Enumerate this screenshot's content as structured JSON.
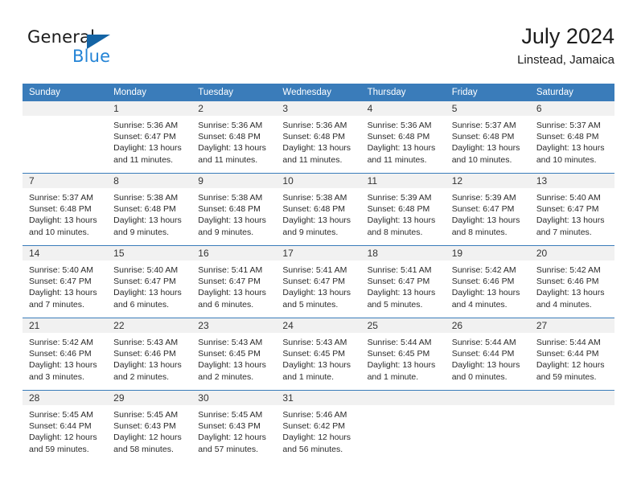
{
  "brand": {
    "word_one": "General",
    "word_two": "Blue",
    "accent_color": "#2484d6",
    "triangle_color": "#1464a5",
    "triangle_icon": "triangle-icon"
  },
  "header": {
    "title": "July 2024",
    "subtitle": "Linstead, Jamaica"
  },
  "theme": {
    "header_blue": "#3a7cba",
    "date_band_gray": "#f1f1f1",
    "text_color": "#2a2a2a"
  },
  "calendar": {
    "day_names": [
      "Sunday",
      "Monday",
      "Tuesday",
      "Wednesday",
      "Thursday",
      "Friday",
      "Saturday"
    ],
    "weeks": [
      [
        {
          "day": "",
          "lines": []
        },
        {
          "day": "1",
          "lines": [
            "Sunrise: 5:36 AM",
            "Sunset: 6:47 PM",
            "Daylight: 13 hours",
            "and 11 minutes."
          ]
        },
        {
          "day": "2",
          "lines": [
            "Sunrise: 5:36 AM",
            "Sunset: 6:48 PM",
            "Daylight: 13 hours",
            "and 11 minutes."
          ]
        },
        {
          "day": "3",
          "lines": [
            "Sunrise: 5:36 AM",
            "Sunset: 6:48 PM",
            "Daylight: 13 hours",
            "and 11 minutes."
          ]
        },
        {
          "day": "4",
          "lines": [
            "Sunrise: 5:36 AM",
            "Sunset: 6:48 PM",
            "Daylight: 13 hours",
            "and 11 minutes."
          ]
        },
        {
          "day": "5",
          "lines": [
            "Sunrise: 5:37 AM",
            "Sunset: 6:48 PM",
            "Daylight: 13 hours",
            "and 10 minutes."
          ]
        },
        {
          "day": "6",
          "lines": [
            "Sunrise: 5:37 AM",
            "Sunset: 6:48 PM",
            "Daylight: 13 hours",
            "and 10 minutes."
          ]
        }
      ],
      [
        {
          "day": "7",
          "lines": [
            "Sunrise: 5:37 AM",
            "Sunset: 6:48 PM",
            "Daylight: 13 hours",
            "and 10 minutes."
          ]
        },
        {
          "day": "8",
          "lines": [
            "Sunrise: 5:38 AM",
            "Sunset: 6:48 PM",
            "Daylight: 13 hours",
            "and 9 minutes."
          ]
        },
        {
          "day": "9",
          "lines": [
            "Sunrise: 5:38 AM",
            "Sunset: 6:48 PM",
            "Daylight: 13 hours",
            "and 9 minutes."
          ]
        },
        {
          "day": "10",
          "lines": [
            "Sunrise: 5:38 AM",
            "Sunset: 6:48 PM",
            "Daylight: 13 hours",
            "and 9 minutes."
          ]
        },
        {
          "day": "11",
          "lines": [
            "Sunrise: 5:39 AM",
            "Sunset: 6:48 PM",
            "Daylight: 13 hours",
            "and 8 minutes."
          ]
        },
        {
          "day": "12",
          "lines": [
            "Sunrise: 5:39 AM",
            "Sunset: 6:47 PM",
            "Daylight: 13 hours",
            "and 8 minutes."
          ]
        },
        {
          "day": "13",
          "lines": [
            "Sunrise: 5:40 AM",
            "Sunset: 6:47 PM",
            "Daylight: 13 hours",
            "and 7 minutes."
          ]
        }
      ],
      [
        {
          "day": "14",
          "lines": [
            "Sunrise: 5:40 AM",
            "Sunset: 6:47 PM",
            "Daylight: 13 hours",
            "and 7 minutes."
          ]
        },
        {
          "day": "15",
          "lines": [
            "Sunrise: 5:40 AM",
            "Sunset: 6:47 PM",
            "Daylight: 13 hours",
            "and 6 minutes."
          ]
        },
        {
          "day": "16",
          "lines": [
            "Sunrise: 5:41 AM",
            "Sunset: 6:47 PM",
            "Daylight: 13 hours",
            "and 6 minutes."
          ]
        },
        {
          "day": "17",
          "lines": [
            "Sunrise: 5:41 AM",
            "Sunset: 6:47 PM",
            "Daylight: 13 hours",
            "and 5 minutes."
          ]
        },
        {
          "day": "18",
          "lines": [
            "Sunrise: 5:41 AM",
            "Sunset: 6:47 PM",
            "Daylight: 13 hours",
            "and 5 minutes."
          ]
        },
        {
          "day": "19",
          "lines": [
            "Sunrise: 5:42 AM",
            "Sunset: 6:46 PM",
            "Daylight: 13 hours",
            "and 4 minutes."
          ]
        },
        {
          "day": "20",
          "lines": [
            "Sunrise: 5:42 AM",
            "Sunset: 6:46 PM",
            "Daylight: 13 hours",
            "and 4 minutes."
          ]
        }
      ],
      [
        {
          "day": "21",
          "lines": [
            "Sunrise: 5:42 AM",
            "Sunset: 6:46 PM",
            "Daylight: 13 hours",
            "and 3 minutes."
          ]
        },
        {
          "day": "22",
          "lines": [
            "Sunrise: 5:43 AM",
            "Sunset: 6:46 PM",
            "Daylight: 13 hours",
            "and 2 minutes."
          ]
        },
        {
          "day": "23",
          "lines": [
            "Sunrise: 5:43 AM",
            "Sunset: 6:45 PM",
            "Daylight: 13 hours",
            "and 2 minutes."
          ]
        },
        {
          "day": "24",
          "lines": [
            "Sunrise: 5:43 AM",
            "Sunset: 6:45 PM",
            "Daylight: 13 hours",
            "and 1 minute."
          ]
        },
        {
          "day": "25",
          "lines": [
            "Sunrise: 5:44 AM",
            "Sunset: 6:45 PM",
            "Daylight: 13 hours",
            "and 1 minute."
          ]
        },
        {
          "day": "26",
          "lines": [
            "Sunrise: 5:44 AM",
            "Sunset: 6:44 PM",
            "Daylight: 13 hours",
            "and 0 minutes."
          ]
        },
        {
          "day": "27",
          "lines": [
            "Sunrise: 5:44 AM",
            "Sunset: 6:44 PM",
            "Daylight: 12 hours",
            "and 59 minutes."
          ]
        }
      ],
      [
        {
          "day": "28",
          "lines": [
            "Sunrise: 5:45 AM",
            "Sunset: 6:44 PM",
            "Daylight: 12 hours",
            "and 59 minutes."
          ]
        },
        {
          "day": "29",
          "lines": [
            "Sunrise: 5:45 AM",
            "Sunset: 6:43 PM",
            "Daylight: 12 hours",
            "and 58 minutes."
          ]
        },
        {
          "day": "30",
          "lines": [
            "Sunrise: 5:45 AM",
            "Sunset: 6:43 PM",
            "Daylight: 12 hours",
            "and 57 minutes."
          ]
        },
        {
          "day": "31",
          "lines": [
            "Sunrise: 5:46 AM",
            "Sunset: 6:42 PM",
            "Daylight: 12 hours",
            "and 56 minutes."
          ]
        },
        {
          "day": "",
          "lines": []
        },
        {
          "day": "",
          "lines": []
        },
        {
          "day": "",
          "lines": []
        }
      ]
    ]
  }
}
